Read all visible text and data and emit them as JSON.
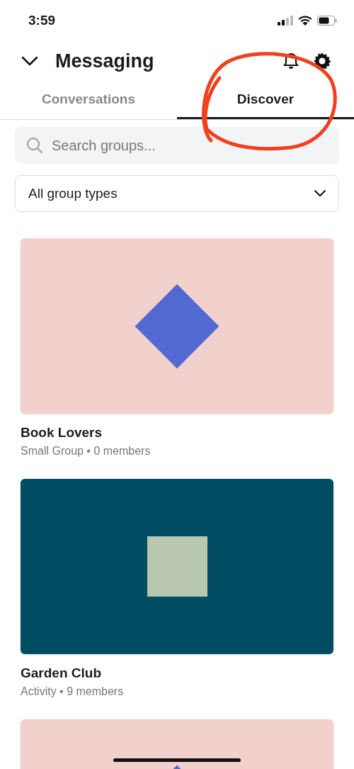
{
  "status_bar": {
    "time": "3:59"
  },
  "header": {
    "title": "Messaging"
  },
  "tabs": [
    {
      "label": "Conversations",
      "selected": false
    },
    {
      "label": "Discover",
      "selected": true
    }
  ],
  "search": {
    "placeholder": "Search groups..."
  },
  "filter": {
    "value": "All group types"
  },
  "groups": [
    {
      "name": "Book Lovers",
      "meta": "Small Group • 0 members",
      "color": "#f2d0cb",
      "shape": {
        "kind": "diamond",
        "color": "#5169d1"
      }
    },
    {
      "name": "Garden Club",
      "meta": "Activity • 9 members",
      "color": "#004c63",
      "shape": {
        "kind": "square",
        "color": "#b9c6b0"
      }
    },
    {
      "color": "#f2d0cb",
      "shape": {
        "kind": "diamond",
        "color": "#5169d1"
      }
    }
  ]
}
